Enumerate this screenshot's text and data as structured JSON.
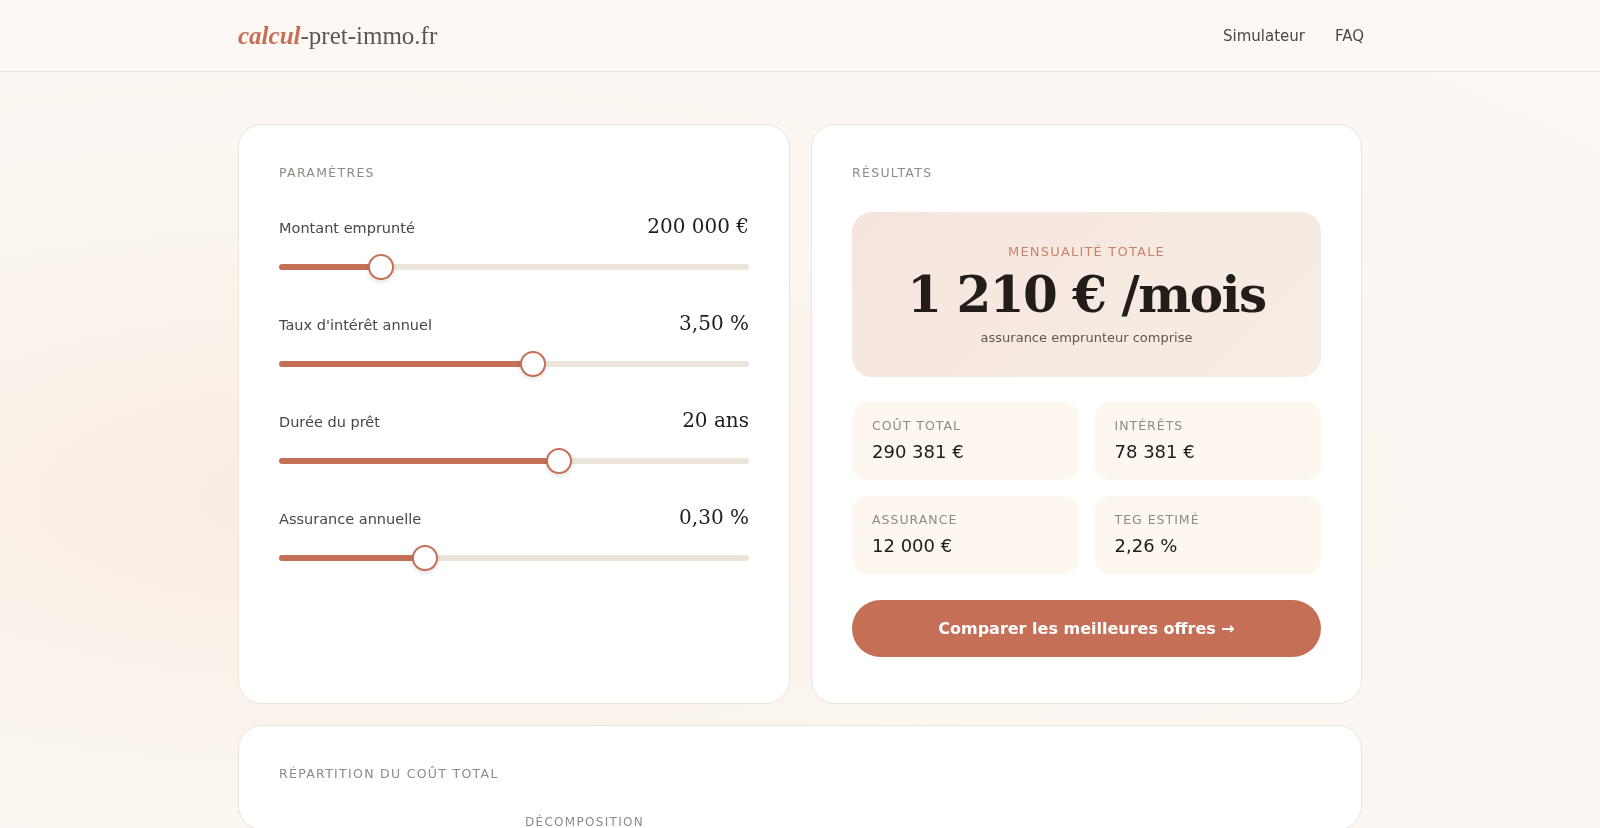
{
  "header": {
    "logo": "*calcul*-pret-immo.fr",
    "nav": [
      {
        "label": "Simulateur"
      },
      {
        "label": "FAQ"
      }
    ]
  },
  "parameters": {
    "title": "PARAMÈTRES",
    "sliders": [
      {
        "label": "Montant emprunté",
        "value": "200 000 €",
        "level": 0.217
      },
      {
        "label": "Taux d'intérêt annuel",
        "value": "3,50 %",
        "level": 0.54
      },
      {
        "label": "Durée du prêt",
        "value": "20 ans",
        "level": 0.595
      },
      {
        "label": "Assurance annuelle",
        "value": "0,30 %",
        "level": 0.31
      }
    ]
  },
  "results": {
    "title": "RÉSULTATS",
    "monthly": {
      "label": "MENSUALITÉ TOTALE",
      "amount": "1 210 € /mois",
      "note": "assurance emprunteur comprise"
    },
    "stats": [
      {
        "label": "COÛT TOTAL",
        "value": "290 381 €"
      },
      {
        "label": "INTÉRÊTS",
        "value": "78 381 €"
      },
      {
        "label": "ASSURANCE",
        "value": "12 000 €"
      },
      {
        "label": "TEG ESTIMÉ",
        "value": "2,26 %"
      }
    ],
    "button": "Comparer les meilleures offres →"
  },
  "breakdown": {
    "title": "RÉPARTITION DU COÛT TOTAL",
    "subtitle": "DÉCOMPOSITION"
  }
}
